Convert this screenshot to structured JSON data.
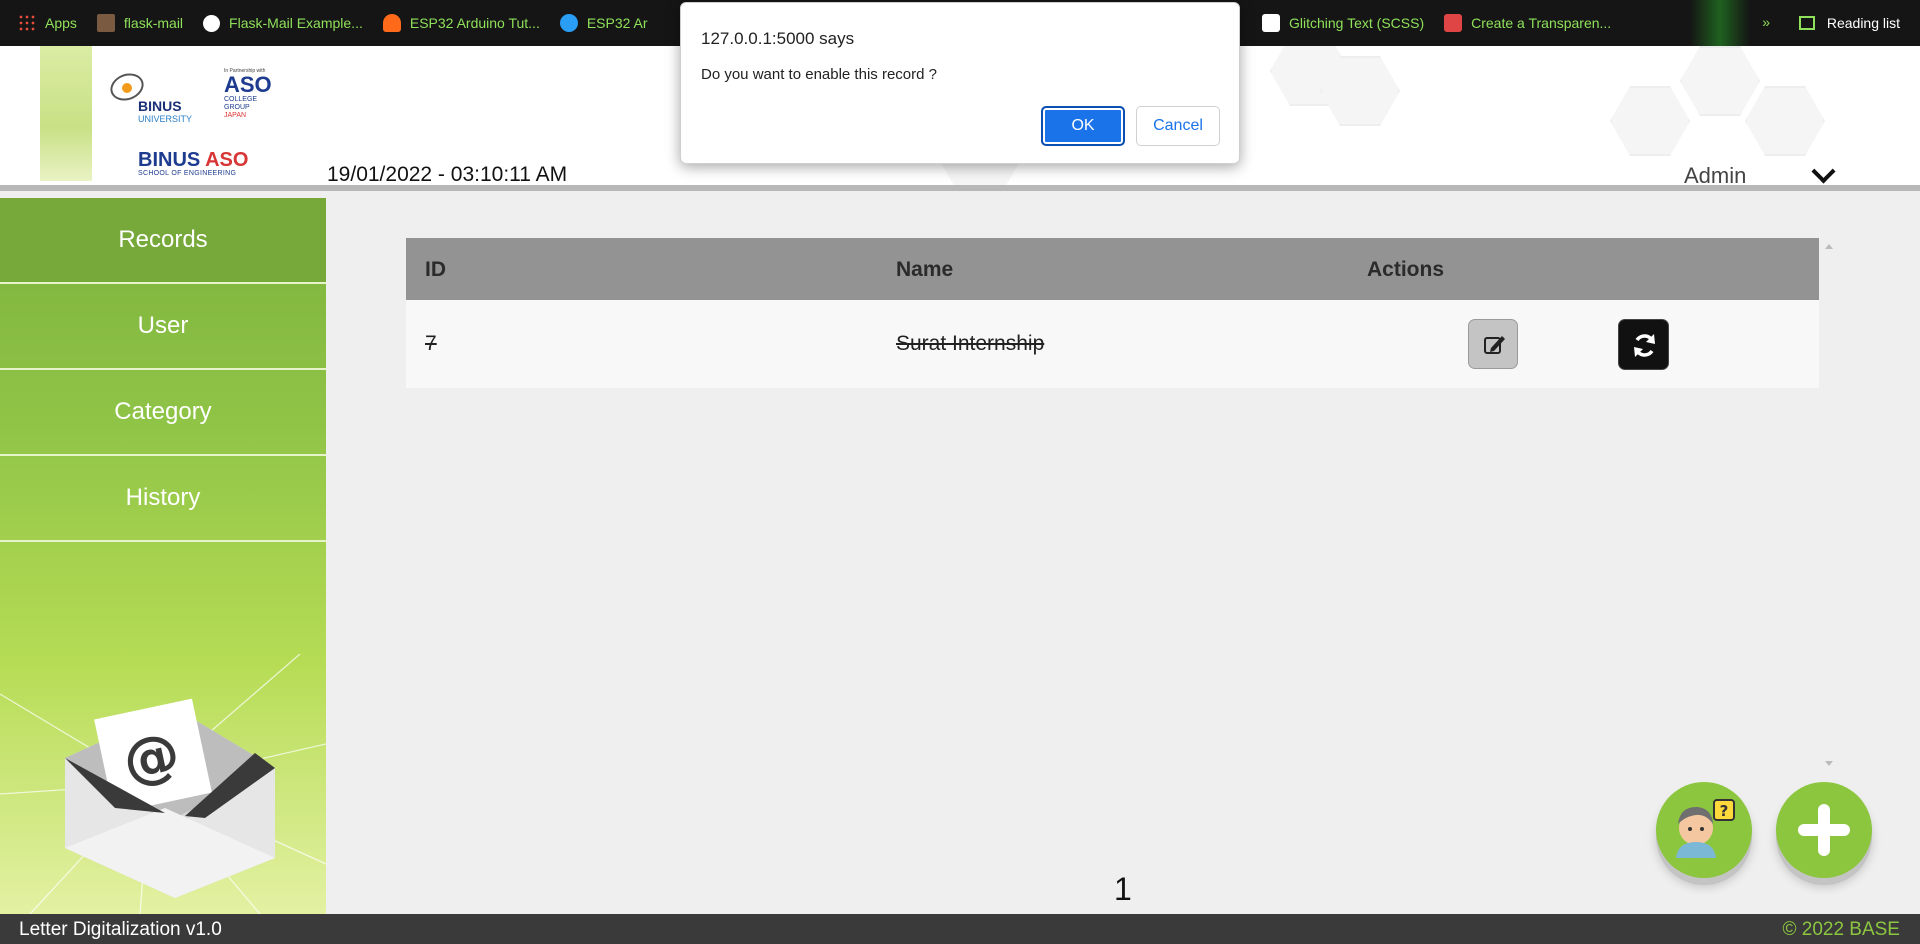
{
  "bookmarks_bar": {
    "items": [
      {
        "label": "Apps",
        "icon": "apps-grid-icon"
      },
      {
        "label": "flask-mail",
        "icon": "avatar-icon"
      },
      {
        "label": "Flask-Mail Example...",
        "icon": "github-icon"
      },
      {
        "label": "ESP32 Arduino Tut...",
        "icon": "robot-icon"
      },
      {
        "label": "ESP32 Ar",
        "icon": "ttx-icon"
      },
      {
        "label": "Glitching Text (SCSS)",
        "icon": "codepen-icon"
      },
      {
        "label": "Create a Transparen...",
        "icon": "wrench-icon"
      }
    ],
    "overflow": "»",
    "reading_list": "Reading list"
  },
  "header": {
    "logo_binus_name": "BINUS",
    "logo_binus_sub": "UNIVERSITY",
    "logo_aso_tiny": "In Partnership with",
    "logo_aso_big": "ASO",
    "logo_aso_sub1": "COLLEGE",
    "logo_aso_sub2": "GROUP",
    "logo_aso_jp": "JAPAN",
    "logo_school_b1": "BINUS",
    "logo_school_b2": "ASO",
    "logo_school_sub": "SCHOOL OF ENGINEERING",
    "datetime": "19/01/2022 - 03:10:11 AM",
    "user": "Admin"
  },
  "sidebar": {
    "items": [
      {
        "label": "Records",
        "active": true
      },
      {
        "label": "User",
        "active": false
      },
      {
        "label": "Category",
        "active": false
      },
      {
        "label": "History",
        "active": false
      }
    ]
  },
  "table": {
    "headers": [
      "ID",
      "Name",
      "Actions"
    ],
    "rows": [
      {
        "id": "7",
        "name": "Surat Internship",
        "disabled": true
      }
    ]
  },
  "pagination": {
    "current": "1"
  },
  "footer": {
    "left": "Letter Digitalization v1.0",
    "right": "© 2022 BASE"
  },
  "dialog": {
    "origin": "127.0.0.1:5000 says",
    "message": "Do you want to enable this record ?",
    "ok": "OK",
    "cancel": "Cancel"
  },
  "colors": {
    "accent_green": "#8cc63f",
    "sidebar_active": "#77a83a",
    "table_header": "#939393",
    "footer_bg": "#3a3a3a",
    "dialog_ok": "#1a73e8"
  }
}
